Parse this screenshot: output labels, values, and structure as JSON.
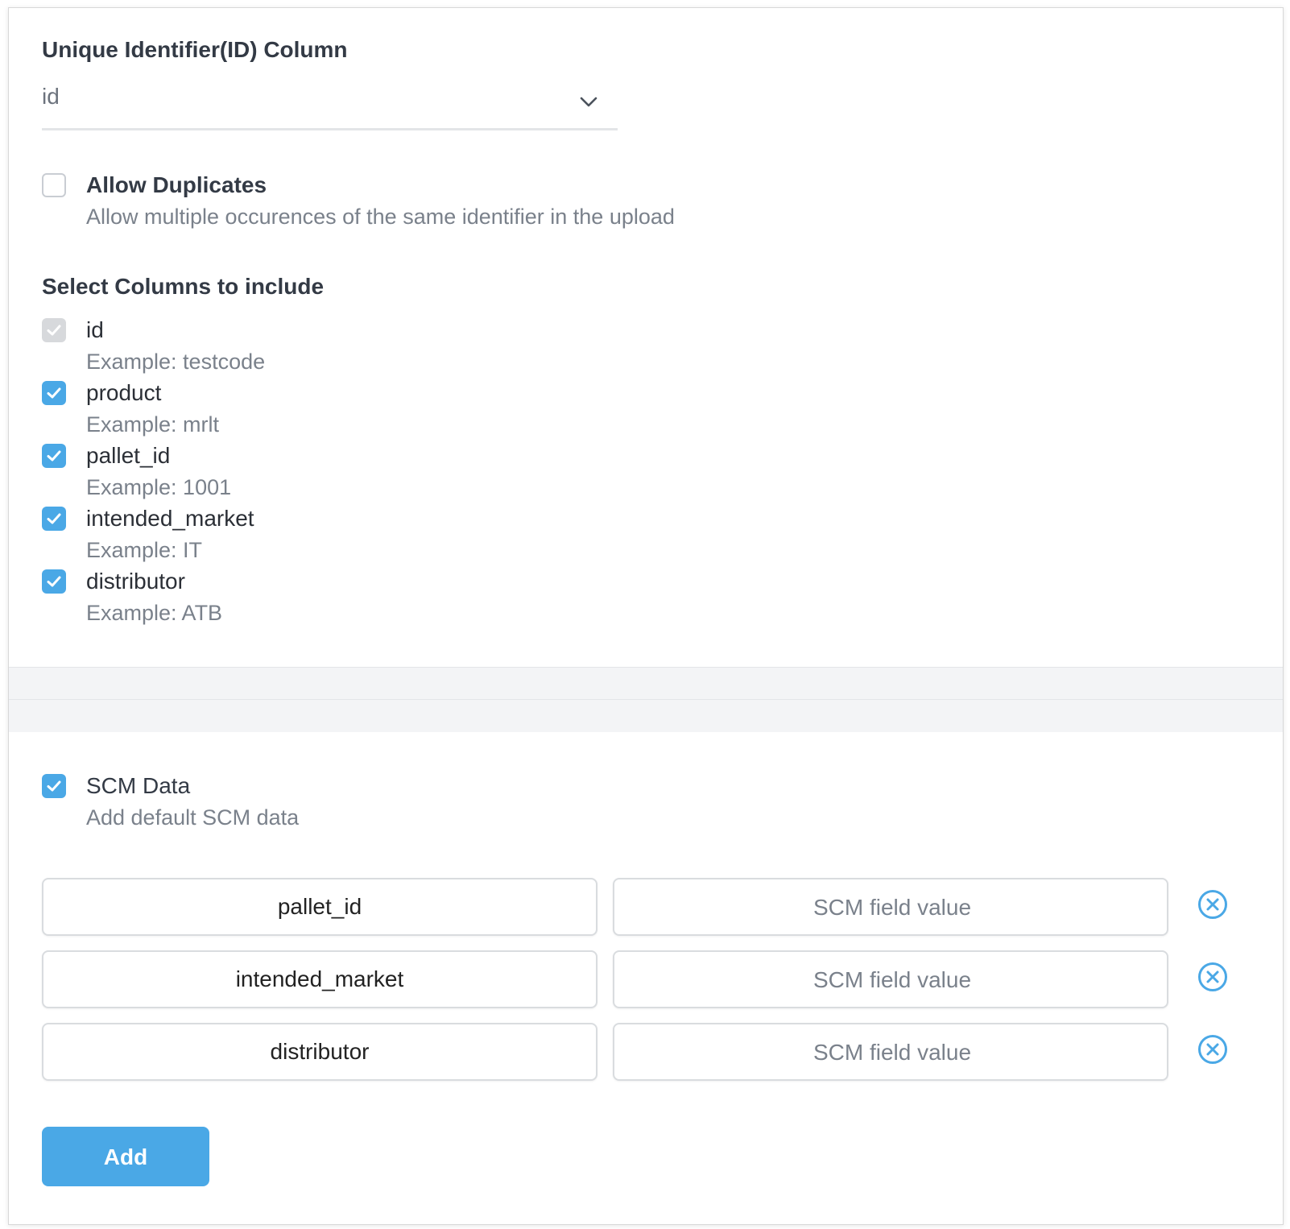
{
  "id_column": {
    "label": "Unique Identifier(ID) Column",
    "selected": "id",
    "icon": "chevron-down-icon"
  },
  "allow_duplicates": {
    "checked": false,
    "title": "Allow Duplicates",
    "description": "Allow multiple occurences of the same identifier in the upload"
  },
  "columns": {
    "heading": "Select Columns to include",
    "items": [
      {
        "name": "id",
        "example": "Example: testcode",
        "state": "disabled-checked"
      },
      {
        "name": "product",
        "example": "Example: mrlt",
        "state": "checked"
      },
      {
        "name": "pallet_id",
        "example": "Example: 1001",
        "state": "checked"
      },
      {
        "name": "intended_market",
        "example": "Example: IT",
        "state": "checked"
      },
      {
        "name": "distributor",
        "example": "Example: ATB",
        "state": "checked"
      }
    ]
  },
  "scm": {
    "checked": true,
    "title": "SCM Data",
    "description": "Add default SCM data",
    "rows": [
      {
        "field": "pallet_id",
        "value": "",
        "value_placeholder": "SCM field value"
      },
      {
        "field": "intended_market",
        "value": "",
        "value_placeholder": "SCM field value"
      },
      {
        "field": "distributor",
        "value": "",
        "value_placeholder": "SCM field value"
      }
    ],
    "remove_icon": "close-circle-icon",
    "add_label": "Add"
  },
  "colors": {
    "accent": "#4aa8e6",
    "checkbox_disabled": "#d7d9dc",
    "band": "#f3f4f6"
  }
}
